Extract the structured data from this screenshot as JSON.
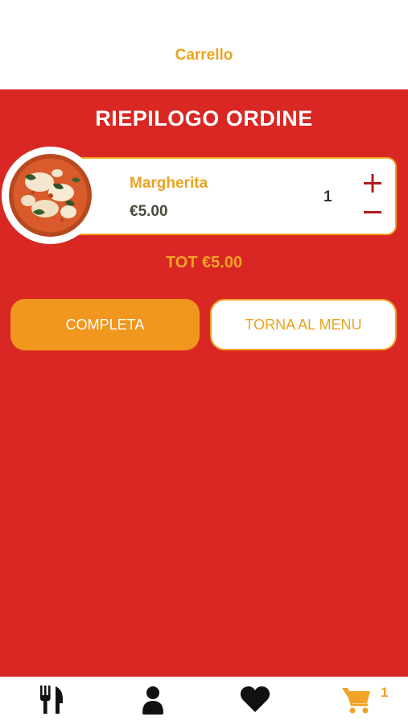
{
  "header": {
    "title": "Carrello"
  },
  "order": {
    "title": "RIEPILOGO ORDINE",
    "items": [
      {
        "name": "Margherita",
        "price": "€5.00",
        "quantity": "1",
        "image": "margherita-pizza-photo"
      }
    ],
    "total": "TOT €5.00"
  },
  "actions": {
    "complete_label": "COMPLETA",
    "back_label": "TORNA AL MENU"
  },
  "tabbar": {
    "items": [
      {
        "icon": "fork-knife-icon"
      },
      {
        "icon": "user-icon"
      },
      {
        "icon": "heart-icon"
      },
      {
        "icon": "cart-icon",
        "badge": "1"
      }
    ]
  },
  "colors": {
    "background_red": "#D92723",
    "accent_orange": "#E9A31F",
    "button_orange": "#F1961E",
    "card_white": "#FFFFFF"
  }
}
